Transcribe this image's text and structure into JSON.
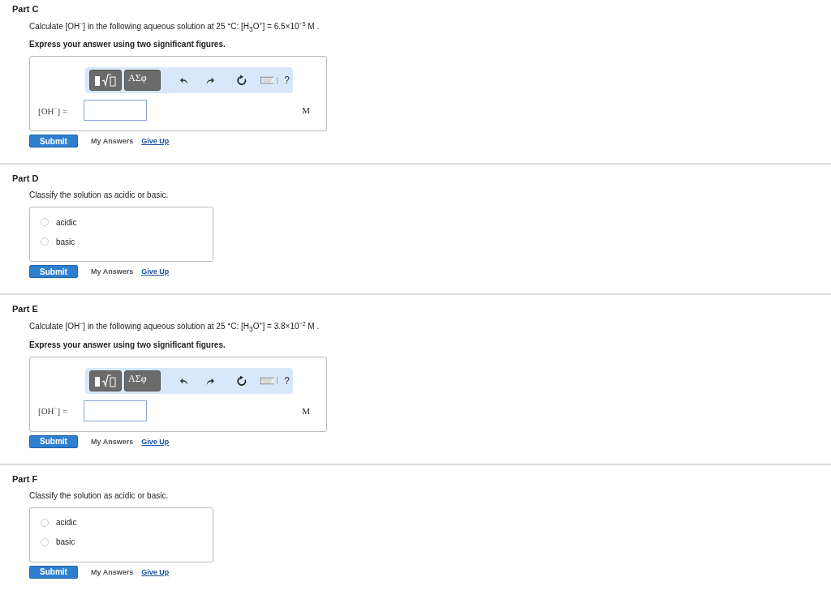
{
  "parts": [
    {
      "kind": "calc",
      "title": "Part C",
      "prompt": "Calculate [OH$^{−}$] in the following aqueous solution at 25 $^{∘}$C: [H$_{3}$O$^{+}$] = 6.5×10$^{−5}$ M .",
      "instruction": "Express your answer using two significant figures.",
      "greek": "ΑΣφ",
      "help": "?",
      "label": "[OH$^{−}$] =",
      "unit": "M",
      "submit": "Submit",
      "my_answers": "My Answers",
      "give_up": "Give Up"
    },
    {
      "kind": "classify",
      "title": "Part D",
      "prompt": "Classify the solution as acidic or basic.",
      "options": [
        {
          "label": "acidic",
          "selected": false
        },
        {
          "label": "basic",
          "selected": false
        }
      ],
      "submit": "Submit",
      "my_answers": "My Answers",
      "give_up": "Give Up"
    },
    {
      "kind": "calc",
      "title": "Part E",
      "prompt": "Calculate [OH$^{−}$] in the following aqueous solution at 25 $^{∘}$C: [H$_{3}$O$^{+}$] = 3.8×10$^{−2}$ M .",
      "instruction": "Express your answer using two significant figures.",
      "greek": "ΑΣφ",
      "help": "?",
      "label": "[OH$^{−}$] =",
      "unit": "M",
      "submit": "Submit",
      "my_answers": "My Answers",
      "give_up": "Give Up"
    },
    {
      "kind": "classify",
      "title": "Part F",
      "prompt": "Classify the solution as acidic or basic.",
      "options": [
        {
          "label": "acidic",
          "selected": false
        },
        {
          "label": "basic",
          "selected": false
        }
      ],
      "submit": "Submit",
      "my_answers": "My Answers",
      "give_up": "Give Up"
    }
  ]
}
